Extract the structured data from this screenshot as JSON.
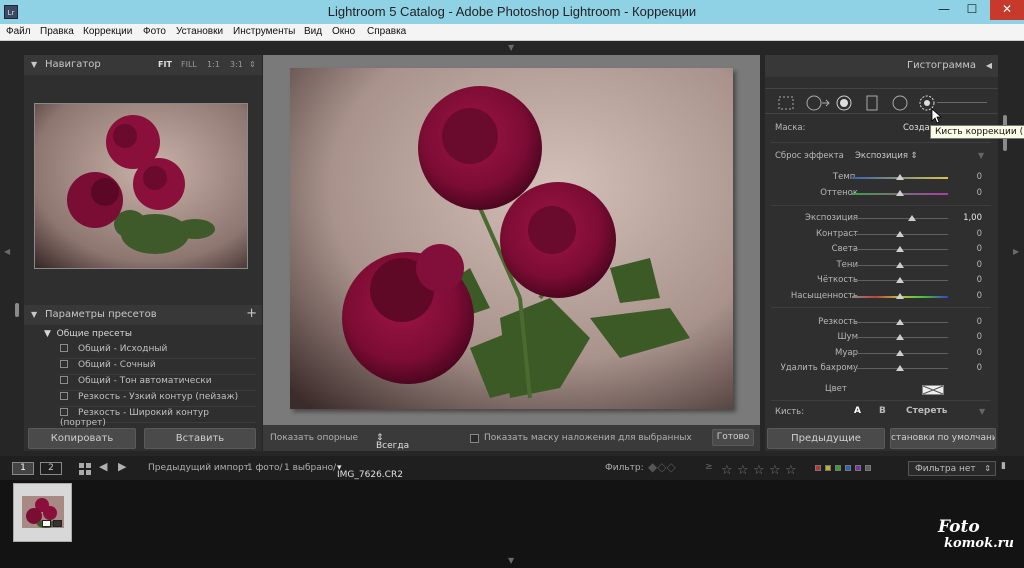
{
  "title_bar": {
    "app_badge": "Lr",
    "title": "Lightroom 5 Catalog - Adobe Photoshop Lightroom - Коррекции",
    "min_glyph": "—",
    "max_glyph": "☐",
    "close_glyph": "✕"
  },
  "menu": [
    "Файл",
    "Правка",
    "Коррекции",
    "Фото",
    "Установки",
    "Инструменты",
    "Вид",
    "Окно",
    "Справка"
  ],
  "left_panel": {
    "navigator": {
      "title": "Навигатор",
      "zoom_options": [
        "FIT",
        "FILL",
        "1:1",
        "3:1"
      ]
    },
    "presets": {
      "title": "Параметры пресетов",
      "add_glyph": "+",
      "group": "Общие пресеты",
      "items": [
        "Общий - Исходный",
        "Общий - Сочный",
        "Общий - Тон автоматически",
        "Резкость - Узкий контур (пейзаж)",
        "Резкость - Широкий контур (портрет)"
      ]
    },
    "copy_button": "Копировать",
    "paste_button": "Вставить"
  },
  "center_toolbar": {
    "show_pins_label": "Показать опорные",
    "show_pins_value": "Всегда",
    "mask_overlay_label": "Показать маску наложения для выбранных",
    "done_button": "Готово"
  },
  "right_panel": {
    "histogram_title": "Гистограмма",
    "mask_label": "Маска:",
    "mask_value": "Создать",
    "tooltip": "Кисть коррекции (K)",
    "reset_label": "Сброс эффекта",
    "effect_value": "Экспозиция",
    "sliders": [
      {
        "label": "Темп.",
        "value": "0",
        "fraction": 0.5,
        "gradient": "temp"
      },
      {
        "label": "Оттенок",
        "value": "0",
        "fraction": 0.5,
        "gradient": "tint"
      },
      {
        "label": "Экспозиция",
        "value": "1,00",
        "fraction": 0.62,
        "gradient": "none"
      },
      {
        "label": "Контраст",
        "value": "0",
        "fraction": 0.5,
        "gradient": "none"
      },
      {
        "label": "Света",
        "value": "0",
        "fraction": 0.5,
        "gradient": "none"
      },
      {
        "label": "Тени",
        "value": "0",
        "fraction": 0.5,
        "gradient": "none"
      },
      {
        "label": "Чёткость",
        "value": "0",
        "fraction": 0.5,
        "gradient": "none"
      },
      {
        "label": "Насыщенность",
        "value": "0",
        "fraction": 0.5,
        "gradient": "sat"
      },
      {
        "label": "Резкость",
        "value": "0",
        "fraction": 0.5,
        "gradient": "none"
      },
      {
        "label": "Шум",
        "value": "0",
        "fraction": 0.5,
        "gradient": "none"
      },
      {
        "label": "Муар",
        "value": "0",
        "fraction": 0.5,
        "gradient": "none"
      },
      {
        "label": "Удалить бахрому",
        "value": "0",
        "fraction": 0.5,
        "gradient": "none"
      }
    ],
    "color_label": "Цвет",
    "brush_label": "Кисть:",
    "brush_a": "A",
    "brush_b": "B",
    "brush_erase": "Стереть",
    "prev_button": "Предыдущие",
    "defaults_button": "становки по умолчанию..."
  },
  "filmstrip_bar": {
    "page1": "1",
    "page2": "2",
    "source": "Предыдущий импорт",
    "count": "1 фото/",
    "selected": "1 выбрано/",
    "filename": "IMG_7626.CR2",
    "filter_label": "Фильтр:",
    "filter_value": "Фильтра нет",
    "label_colors": [
      "#c03030",
      "#c0b030",
      "#30a030",
      "#3060c0",
      "#8030a0",
      "#606060"
    ]
  },
  "watermark": {
    "line1": "Foto",
    "line2": "komok.ru"
  },
  "colors": {
    "accent_title": "#8fd1e5",
    "close": "#c7392b",
    "panel": "#2f2f2f",
    "peony": "#8a0f3a"
  }
}
